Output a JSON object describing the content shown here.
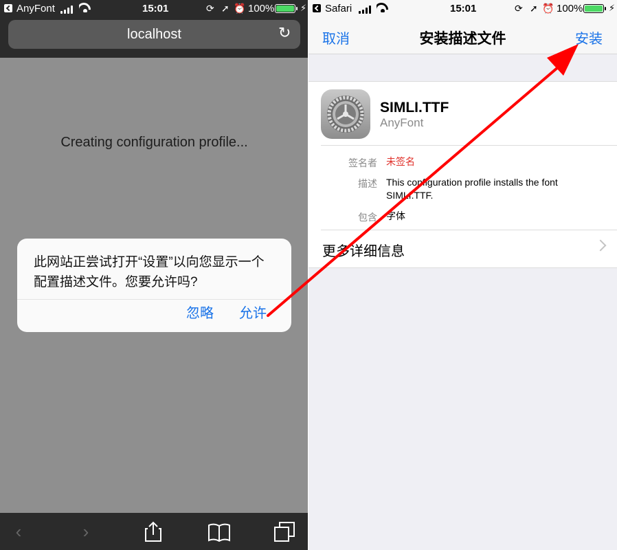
{
  "left": {
    "status": {
      "app": "AnyFont",
      "time": "15:01",
      "battery": "100%"
    },
    "url": "localhost",
    "creating_text": "Creating configuration profile...",
    "dialog": {
      "message": "此网站正尝试打开“设置”以向您显示一个配置描述文件。您要允许吗?",
      "ignore": "忽略",
      "allow": "允许"
    }
  },
  "right": {
    "status": {
      "app": "Safari",
      "time": "15:01",
      "battery": "100%"
    },
    "nav": {
      "cancel": "取消",
      "title": "安装描述文件",
      "install": "安装"
    },
    "profile": {
      "name": "SIMLI.TTF",
      "subtitle": "AnyFont"
    },
    "details": [
      {
        "label": "签名者",
        "value": "未签名",
        "color": "#e0302a"
      },
      {
        "label": "描述",
        "value": "This configuration profile installs the font SIMLI.TTF."
      },
      {
        "label": "包含",
        "value": "字体"
      }
    ],
    "more": "更多详细信息"
  },
  "colors": {
    "accent": "#1a73e8",
    "unsigned": "#e0302a",
    "arrow": "#ff0000"
  },
  "icons": [
    "back-icon",
    "signal-icon",
    "wifi-icon",
    "lock-rotation-icon",
    "location-icon",
    "alarm-icon",
    "battery-icon",
    "charging-icon",
    "reload-icon",
    "gear-icon",
    "chevron-right-icon",
    "share-icon",
    "bookmarks-icon",
    "tabs-icon"
  ]
}
